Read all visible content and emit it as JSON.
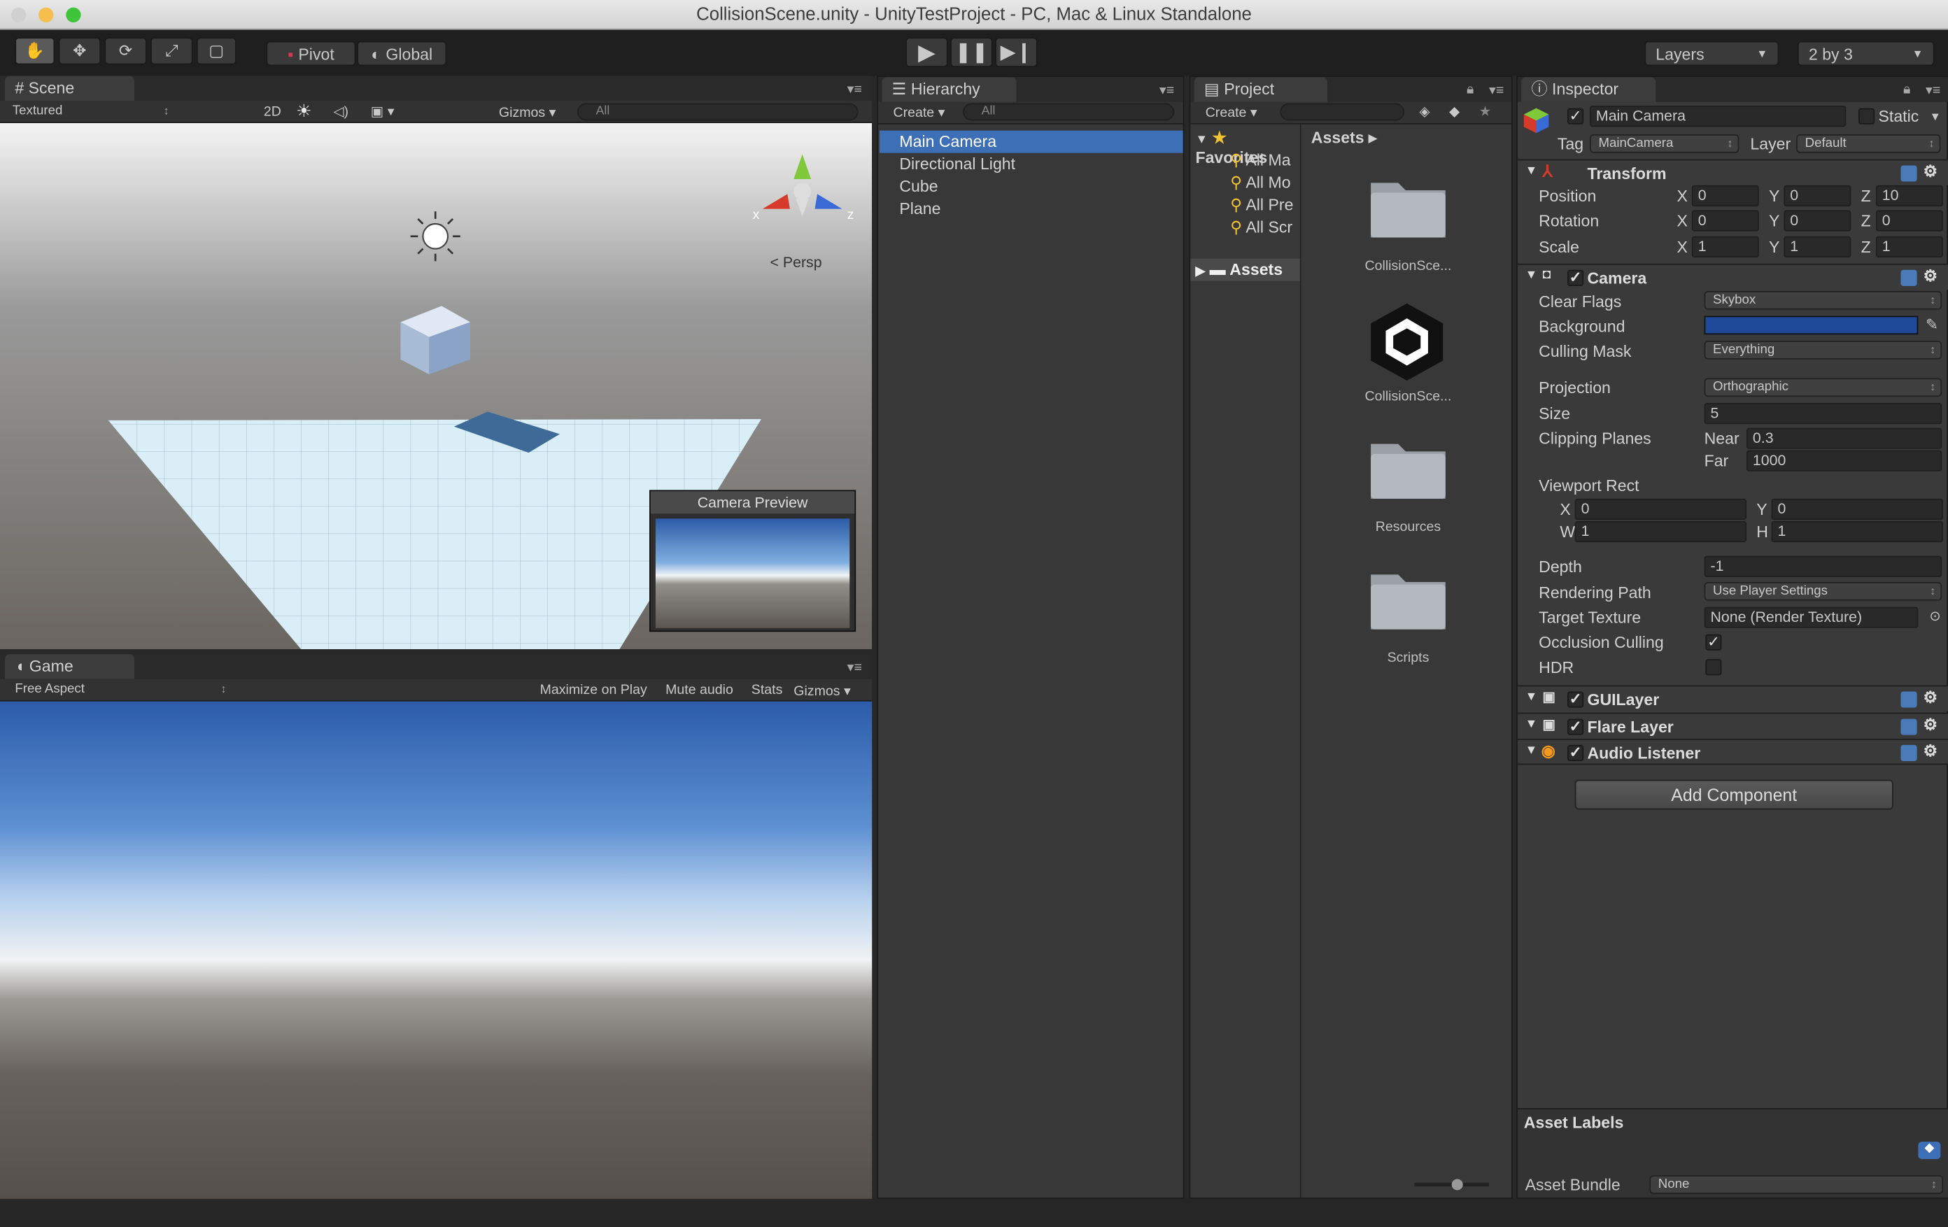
{
  "window": {
    "title": "CollisionScene.unity - UnityTestProject - PC, Mac & Linux Standalone"
  },
  "toolbar": {
    "pivot": "Pivot",
    "global": "Global",
    "layers": "Layers",
    "layout": "2 by 3"
  },
  "scene": {
    "tab": "Scene",
    "render_mode": "Textured",
    "mode_2d": "2D",
    "gizmos": "Gizmos",
    "search": "All",
    "persp": "Persp",
    "axis_x": "x",
    "axis_z": "z",
    "camera_preview": "Camera Preview"
  },
  "game": {
    "tab": "Game",
    "aspect": "Free Aspect",
    "maximize": "Maximize on Play",
    "mute": "Mute audio",
    "stats": "Stats",
    "gizmos": "Gizmos"
  },
  "hierarchy": {
    "tab": "Hierarchy",
    "create": "Create",
    "search": "All",
    "items": [
      "Main Camera",
      "Directional Light",
      "Cube",
      "Plane"
    ],
    "selected": "Main Camera"
  },
  "project": {
    "tab": "Project",
    "create": "Create",
    "favorites": "Favorites",
    "fav_items": [
      "All Ma",
      "All Mo",
      "All Pre",
      "All Scr"
    ],
    "assets_root": "Assets",
    "breadcrumb": "Assets",
    "assets": [
      {
        "name": "CollisionSce...",
        "kind": "folder"
      },
      {
        "name": "CollisionSce...",
        "kind": "unity-scene"
      },
      {
        "name": "Resources",
        "kind": "folder"
      },
      {
        "name": "Scripts",
        "kind": "folder"
      }
    ]
  },
  "inspector": {
    "tab": "Inspector",
    "object_name": "Main Camera",
    "static": "Static",
    "tag_label": "Tag",
    "tag": "MainCamera",
    "layer_label": "Layer",
    "layer": "Default",
    "transform": {
      "title": "Transform",
      "position_label": "Position",
      "rotation_label": "Rotation",
      "scale_label": "Scale",
      "position": {
        "x": "0",
        "y": "0",
        "z": "10"
      },
      "rotation": {
        "x": "0",
        "y": "0",
        "z": "0"
      },
      "scale": {
        "x": "1",
        "y": "1",
        "z": "1"
      }
    },
    "camera": {
      "title": "Camera",
      "clear_flags_label": "Clear Flags",
      "clear_flags": "Skybox",
      "background_label": "Background",
      "background_color": "#1f4a9a",
      "culling_label": "Culling Mask",
      "culling": "Everything",
      "projection_label": "Projection",
      "projection": "Orthographic",
      "size_label": "Size",
      "size": "5",
      "clipping_label": "Clipping Planes",
      "near_label": "Near",
      "near": "0.3",
      "far_label": "Far",
      "far": "1000",
      "viewport_label": "Viewport Rect",
      "vx": "0",
      "vy": "0",
      "vw": "1",
      "vh": "1",
      "depth_label": "Depth",
      "depth": "-1",
      "rendering_label": "Rendering Path",
      "rendering": "Use Player Settings",
      "target_label": "Target Texture",
      "target": "None (Render Texture)",
      "occlusion_label": "Occlusion Culling",
      "hdr_label": "HDR"
    },
    "guilayer": "GUILayer",
    "flare": "Flare Layer",
    "audio": "Audio Listener",
    "add_component": "Add Component",
    "asset_labels": "Asset Labels",
    "asset_bundle_label": "Asset Bundle",
    "asset_bundle": "None"
  }
}
